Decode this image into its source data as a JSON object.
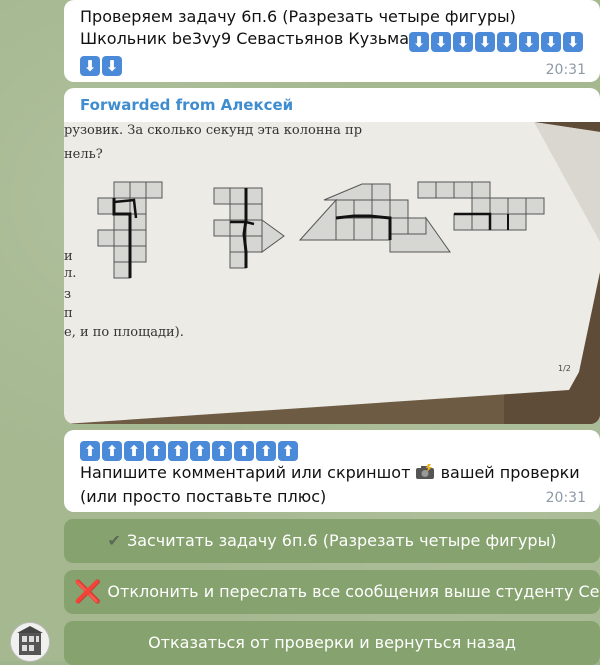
{
  "message1": {
    "line1": "Проверяем задачу 6п.6 (Разрезать четыре фигуры)",
    "line2": "Школьник be3vy9 Севастьянов Кузьма",
    "arrow_glyph": "⬇",
    "time": "20:31"
  },
  "message2": {
    "forwarded": "Forwarded from Алексей",
    "photo_text_top": "рузовик. За сколько секунд эта колонна пр",
    "photo_text_top2": "нель?",
    "photo_text_bottom": "е, и по площади).",
    "photo_page": "1/2"
  },
  "message3": {
    "arrow_glyph": "⬆",
    "line1": "Напишите комментарий или скриншот",
    "line1_end": "вашей проверки",
    "line2": "(или просто поставьте плюс)",
    "time": "20:31"
  },
  "keyboard": {
    "accept_icon": "✔",
    "accept": "Засчитать задачу 6п.6 (Разрезать четыре фигуры)",
    "reject_icon": "❌",
    "reject": "Отклонить и переслать все сообщения выше студенту Се...",
    "refuse": "Отказаться от проверки и вернуться назад"
  },
  "icons": {
    "avatar": "avatar-icon",
    "camera": "camera-flash-icon"
  },
  "colors": {
    "link": "#3f8ccf",
    "button_bg": "#86a36f",
    "arrow_bg": "#4a8ad8"
  }
}
